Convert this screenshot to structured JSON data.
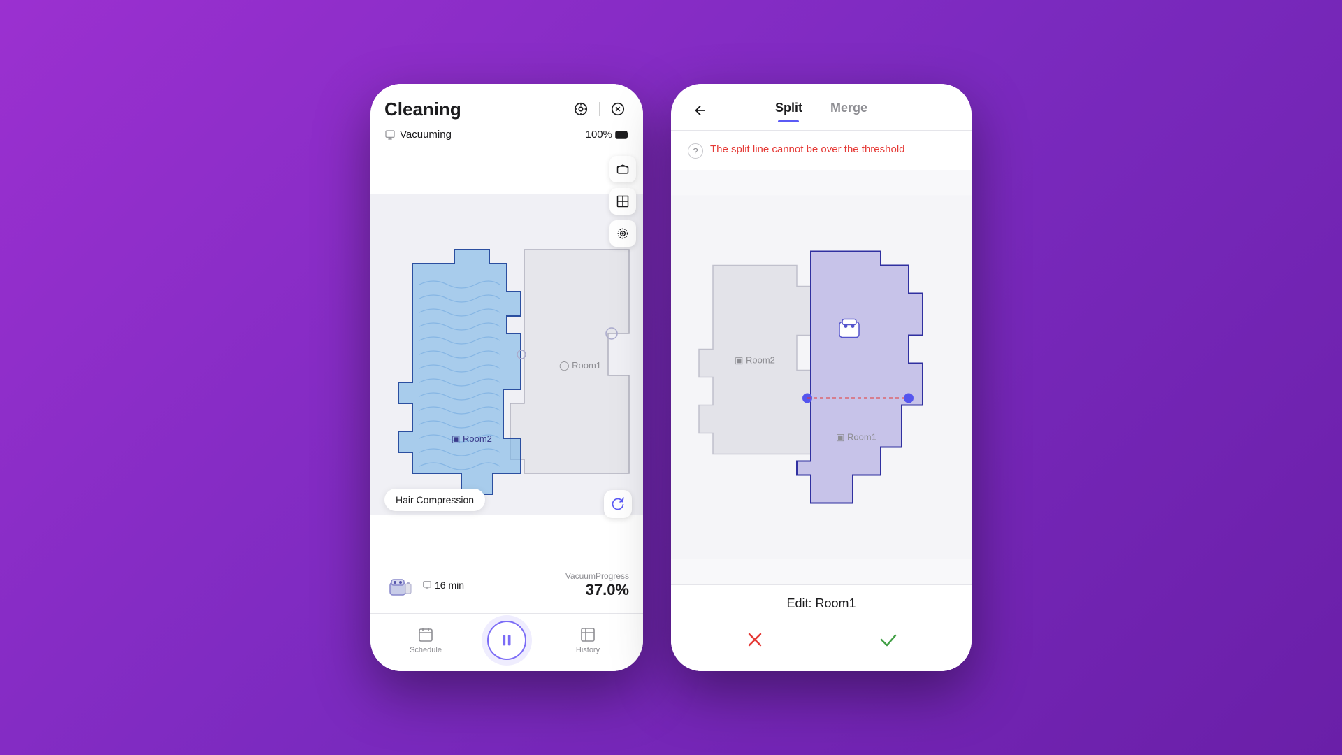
{
  "background": {
    "gradient_start": "#9b30d0",
    "gradient_end": "#6a1fa8"
  },
  "left_phone": {
    "header": {
      "title": "Cleaning",
      "icons": [
        "target-icon",
        "close-icon"
      ]
    },
    "sub_header": {
      "mode_label": "Vacuuming",
      "battery_percent": "100%"
    },
    "map": {
      "room2_label": "Room2",
      "room1_label": "Room1"
    },
    "toolbar": {
      "btn1": "3d-icon",
      "btn2": "grid-icon",
      "btn3": "locate-icon"
    },
    "hair_badge": "Hair Compression",
    "stats": {
      "time_label": "16 min",
      "progress_label": "VacuumProgress",
      "progress_value": "37.0%"
    },
    "nav": {
      "schedule_label": "Schedule",
      "history_label": "History"
    }
  },
  "right_phone": {
    "header": {
      "back_icon": "back-arrow-icon",
      "tab_split": "Split",
      "tab_merge": "Merge"
    },
    "error_message": "The split line cannot be over the threshold",
    "map": {
      "room2_label": "Room2",
      "room1_label": "Room1"
    },
    "edit": {
      "title": "Edit: Room1",
      "cancel_icon": "cancel-icon",
      "confirm_icon": "confirm-icon"
    }
  }
}
